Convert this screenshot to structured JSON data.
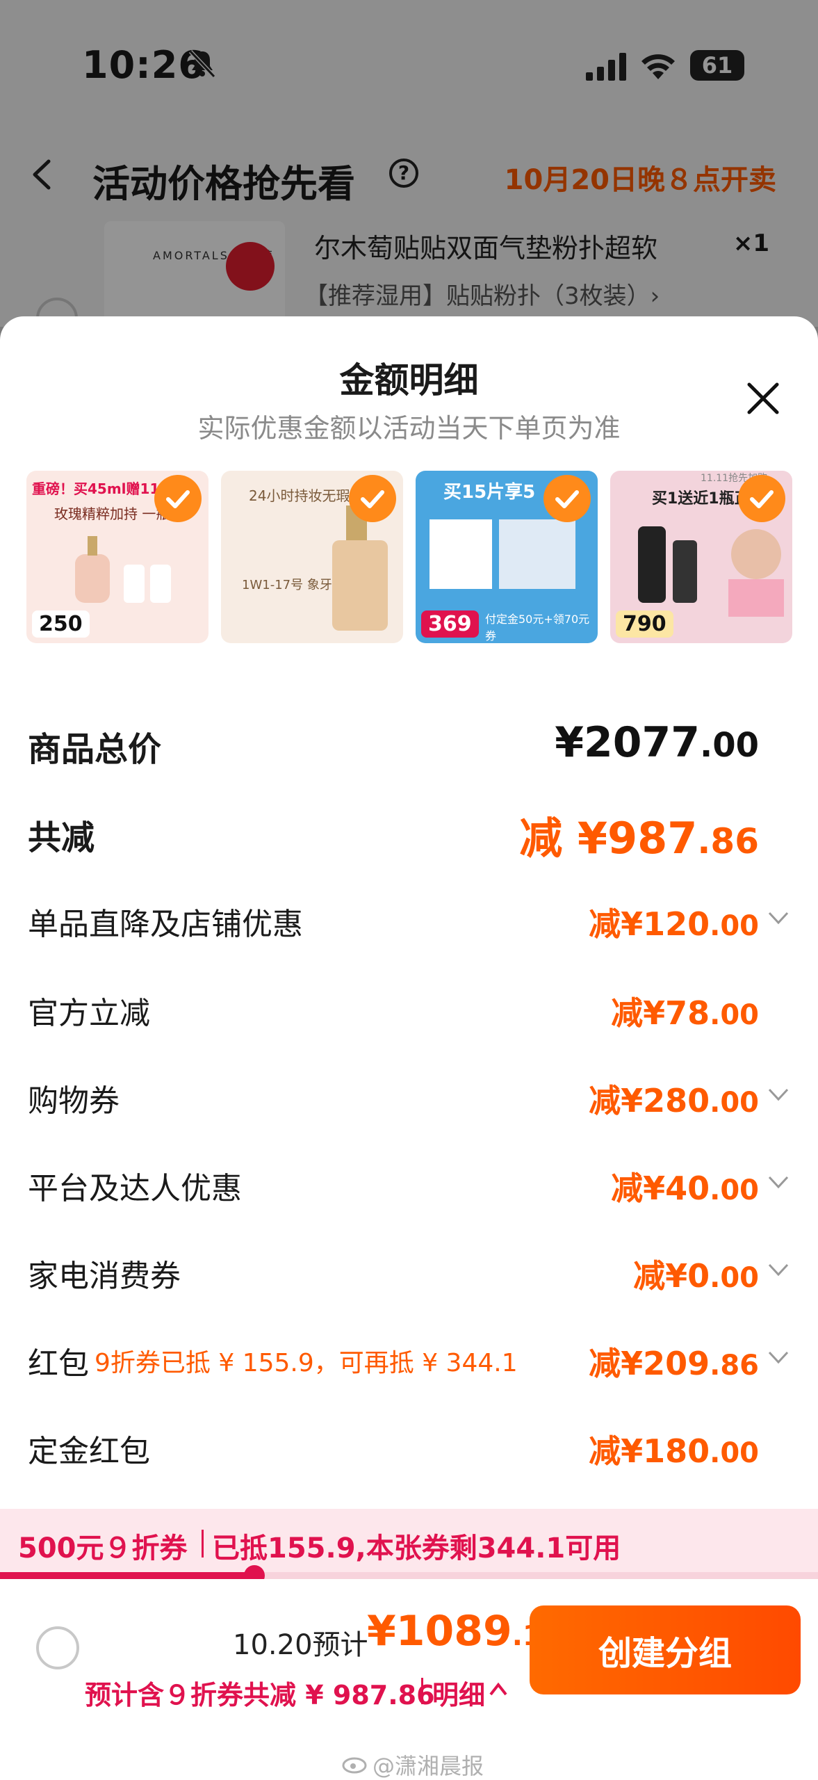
{
  "status": {
    "time": "10:26",
    "battery": "61"
  },
  "background": {
    "title": "活动价格抢先看",
    "help": "?",
    "sale_time": "10月20日晚８点开卖",
    "product_brand": "AMORTALS 尔木萄",
    "product_name": "尔木萄贴贴双面气垫粉扑超软",
    "product_qty": "×1",
    "product_spec": "【推荐湿用】贴贴粉扑（3枚装）›"
  },
  "sheet": {
    "title": "金额明细",
    "subtitle": "实际优惠金额以活动当天下单页为准",
    "thumbnails": [
      {
        "headline": "重磅！买45ml赠11",
        "sub": "玫瑰精粹加持 一瓶定",
        "price": "250",
        "bg": "#fbe9e4"
      },
      {
        "headline": "24小时持妆无瑕",
        "sub": "1W1-17号 象牙白",
        "price": "",
        "bg": "#f7ece3"
      },
      {
        "headline": "买15片享5",
        "sub": "付定金50元+领70元券",
        "price": "369",
        "bg": "#4aa6e0"
      },
      {
        "headline": "买1送近1瓶正装",
        "sub": "11.11抢先加购",
        "price": "790",
        "bg": "#f3d4dc"
      }
    ],
    "rows": {
      "total": {
        "label": "商品总价",
        "prefix": "",
        "int": "¥2077",
        "dec": ".00"
      },
      "reduce": {
        "label": "共减",
        "prefix": "减",
        "int": "¥987",
        "dec": ".86"
      },
      "shop": {
        "label": "单品直降及店铺优惠",
        "prefix": "减",
        "int": "¥120",
        "dec": ".00"
      },
      "official": {
        "label": "官方立减",
        "prefix": "减",
        "int": "¥78",
        "dec": ".00"
      },
      "coupon": {
        "label": "购物券",
        "prefix": "减",
        "int": "¥280",
        "dec": ".00"
      },
      "platform": {
        "label": "平台及达人优惠",
        "prefix": "减",
        "int": "¥40",
        "dec": ".00"
      },
      "appliance": {
        "label": "家电消费券",
        "prefix": "减",
        "int": "¥0",
        "dec": ".00"
      },
      "redpacket": {
        "label": "红包",
        "note": "9折券已抵 ¥ 155.9，可再抵 ¥ 344.1",
        "prefix": "减",
        "int": "¥209",
        "dec": ".86"
      },
      "deposit": {
        "label": "定金红包",
        "prefix": "减",
        "int": "¥180",
        "dec": ".00"
      }
    }
  },
  "coupon_bar": {
    "name": "500元９折券",
    "desc": "已抵155.9,本张券剩344.1可用",
    "progress": 0.311
  },
  "bottom": {
    "est_label": "10.20预计",
    "est_int": "¥1089",
    "est_dec": ".14",
    "est_note": "预计含９折券共减 ¥ 987.86",
    "detail": "明细",
    "create_button": "创建分组"
  },
  "watermark": "@潇湘晨报",
  "colors": {
    "accent": "#ff5a00",
    "coupon": "#e0124e",
    "check": "#ff8a1a"
  }
}
